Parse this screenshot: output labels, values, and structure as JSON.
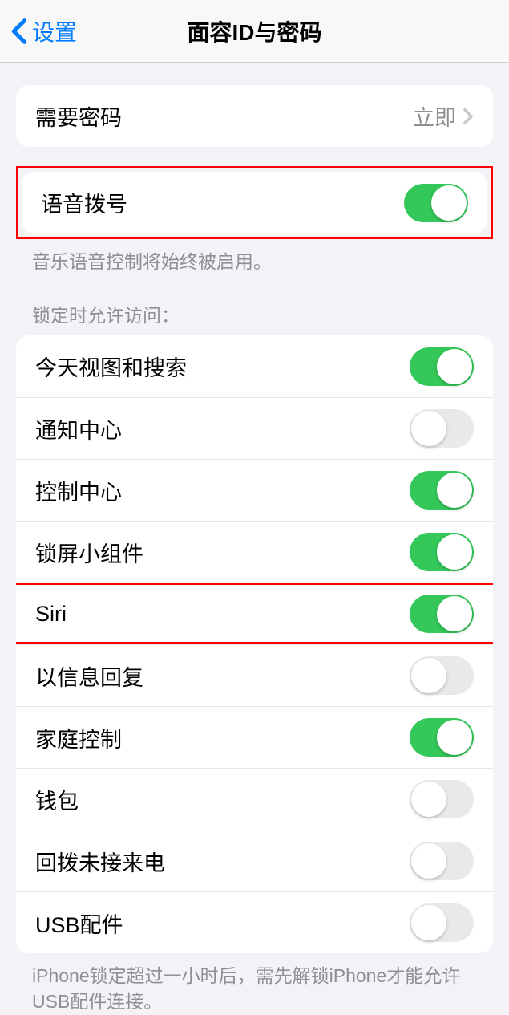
{
  "navbar": {
    "back_label": "设置",
    "title": "面容ID与密码"
  },
  "require_passcode": {
    "label": "需要密码",
    "value": "立即"
  },
  "voice_dial": {
    "label": "语音拨号",
    "footer": "音乐语音控制将始终被启用。",
    "on": true
  },
  "lockscreen": {
    "header": "锁定时允许访问：",
    "items": [
      {
        "label": "今天视图和搜索",
        "on": true
      },
      {
        "label": "通知中心",
        "on": false
      },
      {
        "label": "控制中心",
        "on": true
      },
      {
        "label": "锁屏小组件",
        "on": true
      },
      {
        "label": "Siri",
        "on": true
      },
      {
        "label": "以信息回复",
        "on": false
      },
      {
        "label": "家庭控制",
        "on": true
      },
      {
        "label": "钱包",
        "on": false
      },
      {
        "label": "回拨未接来电",
        "on": false
      },
      {
        "label": "USB配件",
        "on": false
      }
    ],
    "footer": "iPhone锁定超过一小时后，需先解锁iPhone才能允许USB配件连接。"
  }
}
